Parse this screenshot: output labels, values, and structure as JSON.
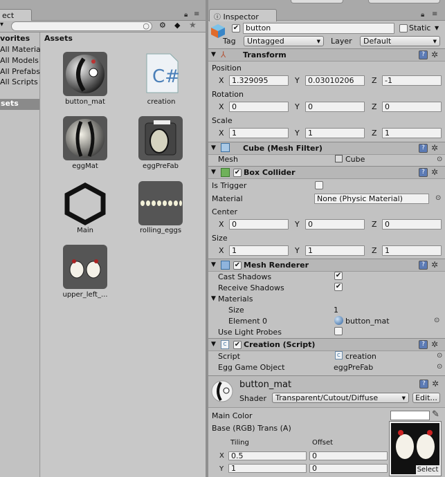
{
  "project": {
    "tab_label": "ect",
    "favorites_header": "vorites",
    "favorites": [
      "All Materia",
      "All Models",
      "All Prefabs",
      "All Scripts"
    ],
    "selected_folder": "sets",
    "assets_header": "Assets",
    "assets": [
      {
        "name": "button_mat",
        "icon": "material-sphere-icon"
      },
      {
        "name": "creation",
        "icon": "csharp-script-icon"
      },
      {
        "name": "eggMat",
        "icon": "material-sphere-icon"
      },
      {
        "name": "eggPreFab",
        "icon": "prefab-icon"
      },
      {
        "name": "Main",
        "icon": "unity-scene-icon"
      },
      {
        "name": "rolling_eggs",
        "icon": "texture-icon"
      },
      {
        "name": "upper_left_...",
        "icon": "texture-icon"
      }
    ]
  },
  "inspector": {
    "tab_label": "Inspector",
    "object": {
      "name": "button",
      "active": true,
      "static_label": "Static",
      "static": false,
      "tag_label": "Tag",
      "tag": "Untagged",
      "layer_label": "Layer",
      "layer": "Default"
    },
    "transform": {
      "title": "Transform",
      "position_label": "Position",
      "position": {
        "x": "1.329095",
        "y": "0.03010206",
        "z": "-1"
      },
      "rotation_label": "Rotation",
      "rotation": {
        "x": "0",
        "y": "0",
        "z": "0"
      },
      "scale_label": "Scale",
      "scale": {
        "x": "1",
        "y": "1",
        "z": "1"
      }
    },
    "mesh_filter": {
      "title": "Cube (Mesh Filter)",
      "mesh_label": "Mesh",
      "mesh": "Cube"
    },
    "box_collider": {
      "title": "Box Collider",
      "is_trigger_label": "Is Trigger",
      "is_trigger": false,
      "material_label": "Material",
      "material": "None (Physic Material)",
      "center_label": "Center",
      "center": {
        "x": "0",
        "y": "0",
        "z": "0"
      },
      "size_label": "Size",
      "size": {
        "x": "1",
        "y": "1",
        "z": "1"
      }
    },
    "mesh_renderer": {
      "title": "Mesh Renderer",
      "cast_shadows_label": "Cast Shadows",
      "receive_shadows_label": "Receive Shadows",
      "materials_label": "Materials",
      "size_label": "Size",
      "size": "1",
      "element0_label": "Element 0",
      "element0": "button_mat",
      "light_probes_label": "Use Light Probes"
    },
    "creation_script": {
      "title": "Creation (Script)",
      "script_label": "Script",
      "script": "creation",
      "egg_label": "Egg Game Object",
      "egg": "eggPreFab"
    },
    "material": {
      "name": "button_mat",
      "shader_label": "Shader",
      "shader": "Transparent/Cutout/Diffuse",
      "edit_label": "Edit...",
      "main_color_label": "Main Color",
      "base_label": "Base (RGB) Trans (A)",
      "tiling_label": "Tiling",
      "offset_label": "Offset",
      "tiling": {
        "x": "0.5",
        "y": "1"
      },
      "offset": {
        "x": "0",
        "y": "0"
      },
      "select_label": "Select"
    },
    "axis": {
      "x": "X",
      "y": "Y",
      "z": "Z"
    }
  }
}
